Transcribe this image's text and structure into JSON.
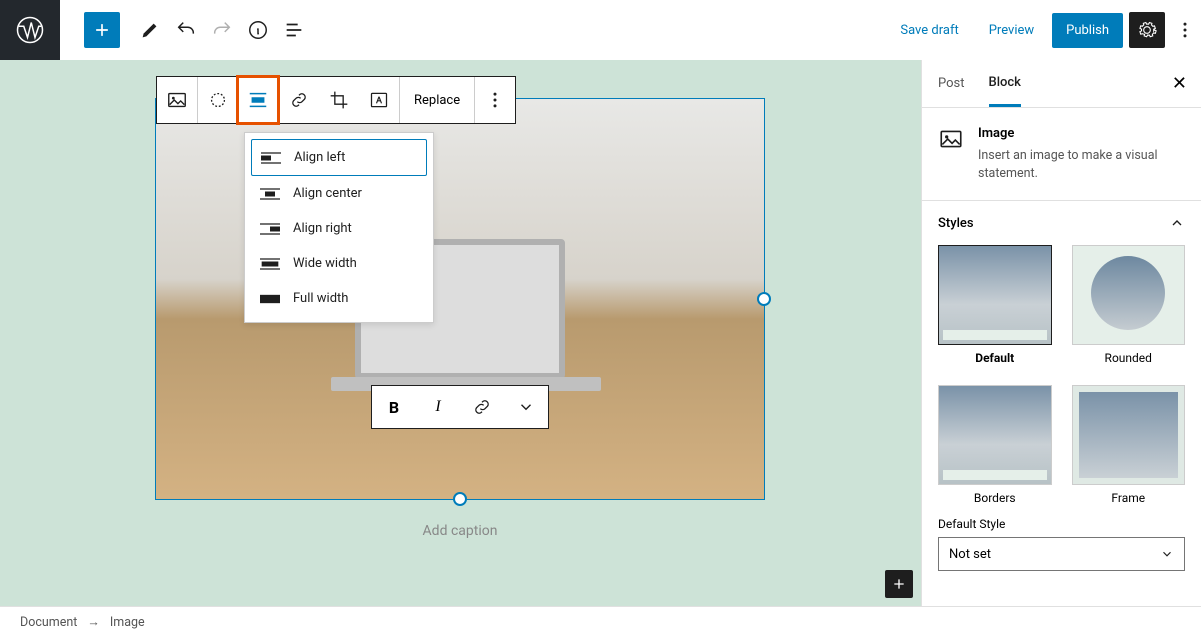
{
  "topbar": {
    "save_draft": "Save draft",
    "preview": "Preview",
    "publish": "Publish"
  },
  "block_toolbar": {
    "replace": "Replace"
  },
  "align_menu": {
    "options": [
      {
        "label": "Align left",
        "selected": true
      },
      {
        "label": "Align center",
        "selected": false
      },
      {
        "label": "Align right",
        "selected": false
      },
      {
        "label": "Wide width",
        "selected": false
      },
      {
        "label": "Full width",
        "selected": false
      }
    ]
  },
  "image_block": {
    "caption_placeholder": "Add caption"
  },
  "sidebar": {
    "tabs": {
      "post": "Post",
      "block": "Block"
    },
    "block_info": {
      "title": "Image",
      "desc": "Insert an image to make a visual statement."
    },
    "styles_heading": "Styles",
    "styles": [
      {
        "name": "Default",
        "selected": true
      },
      {
        "name": "Rounded",
        "selected": false
      },
      {
        "name": "Borders",
        "selected": false
      },
      {
        "name": "Frame",
        "selected": false
      }
    ],
    "default_style_label": "Default Style",
    "default_style_value": "Not set"
  },
  "breadcrumb": {
    "root": "Document",
    "current": "Image"
  }
}
